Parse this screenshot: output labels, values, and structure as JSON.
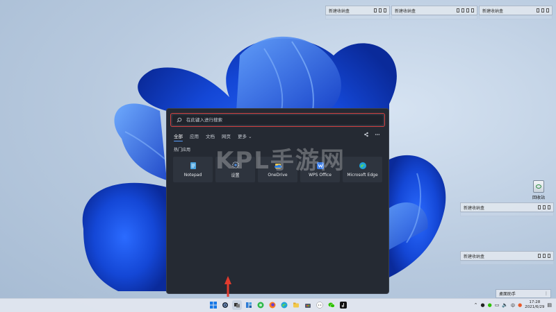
{
  "desktop": {
    "fences": [
      {
        "title": "新建收纳盒"
      },
      {
        "title": "新建收纳盒"
      },
      {
        "title": "新建收纳盒"
      },
      {
        "title": "新建收纳盒"
      },
      {
        "title": "新建收纳盒"
      }
    ],
    "recycle_bin_label": "回收站",
    "helper_label": "桌面助手"
  },
  "search_panel": {
    "placeholder": "在此键入进行搜索",
    "tabs": [
      "全部",
      "应用",
      "文档",
      "网页",
      "更多 ⌄"
    ],
    "section_title": "热门应用",
    "apps": [
      {
        "name": "Notepad",
        "icon": "notepad-icon",
        "color": "#4aa3df"
      },
      {
        "name": "设置",
        "icon": "settings-gear-icon",
        "color": "#9aa4b2"
      },
      {
        "name": "OneDrive",
        "icon": "onedrive-icon",
        "color": "#f2c94c"
      },
      {
        "name": "WPS Office",
        "icon": "wps-office-icon",
        "color": "#3b7de8"
      },
      {
        "name": "Microsoft Edge",
        "icon": "edge-icon",
        "color": "#1fa3d9"
      }
    ]
  },
  "watermark": "KPL手游网",
  "taskbar": {
    "icons": [
      "windows-start-icon",
      "search-icon",
      "task-view-icon",
      "widgets-icon",
      "green-app-icon",
      "firefox-icon",
      "edge-icon",
      "file-explorer-icon",
      "store-icon",
      "chat-icon",
      "wechat-icon",
      "tiktok-icon"
    ],
    "tray_lang": "中",
    "time": "17:28",
    "date": "2021/6/29"
  }
}
